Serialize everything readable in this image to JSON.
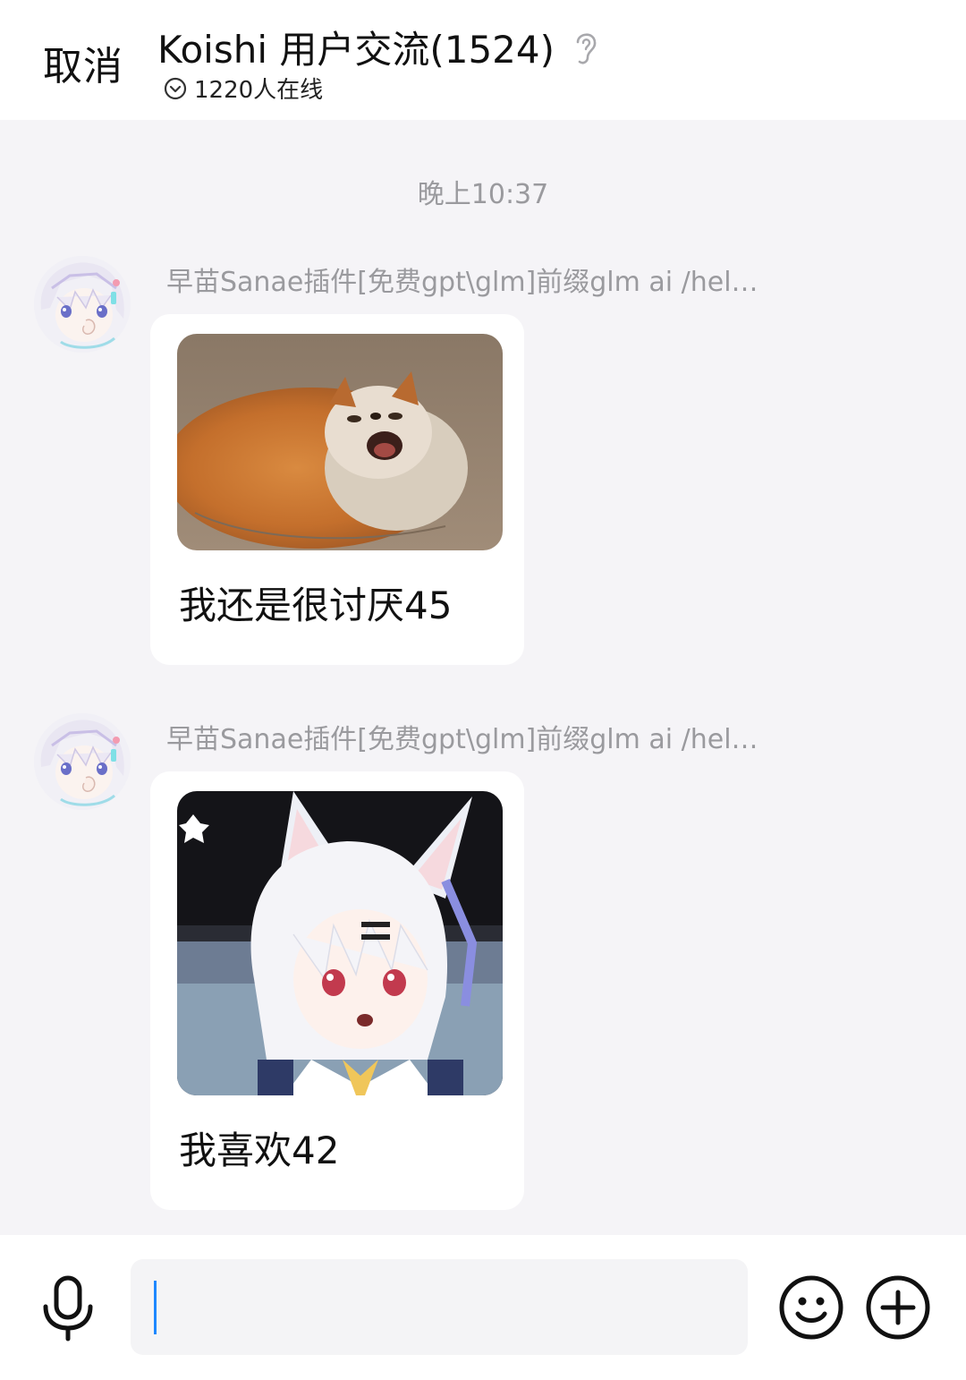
{
  "header": {
    "cancel_label": "取消",
    "title": "Koishi 用户交流(1524)",
    "online_text": "1220人在线"
  },
  "chat": {
    "timestamp": "晚上10:37",
    "messages": [
      {
        "sender": "早苗Sanae插件[免费gpt\\glm]前缀glm ai /hel…",
        "image": "fox-photo",
        "text": "我还是很讨厌45"
      },
      {
        "sender": "早苗Sanae插件[免费gpt\\glm]前缀glm ai /hel…",
        "image": "anime-fox-girl",
        "text": "我喜欢42"
      }
    ]
  },
  "input_bar": {
    "value": "",
    "icons": [
      "microphone-icon",
      "emoji-icon",
      "plus-icon"
    ]
  },
  "colors": {
    "background": "#f5f4f7",
    "bubble": "#ffffff",
    "muted_text": "#9a9a9e",
    "caret": "#1e88ff"
  }
}
